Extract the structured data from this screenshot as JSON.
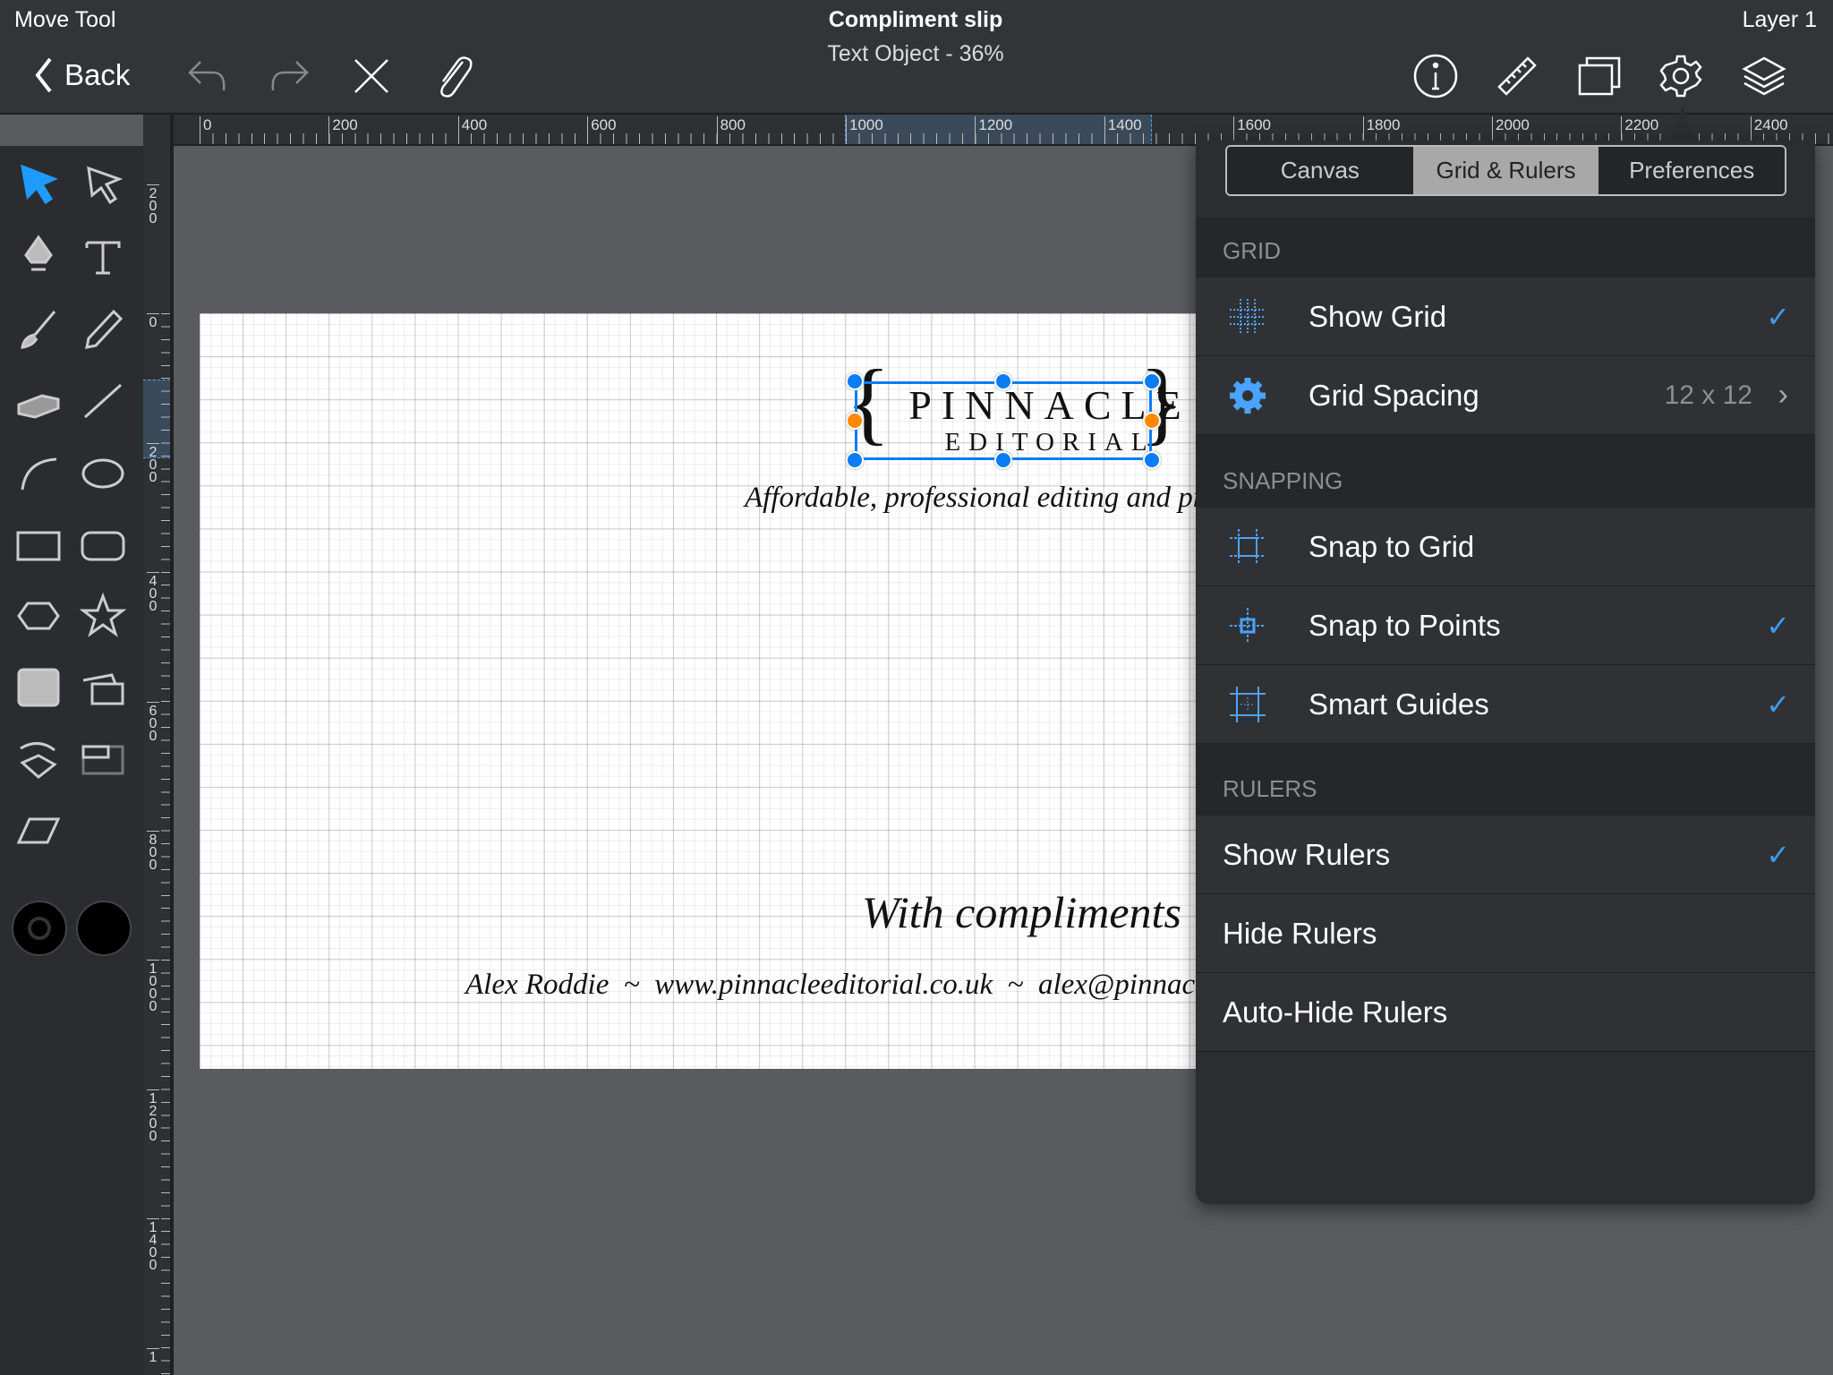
{
  "topbar": {
    "tool_name": "Move Tool",
    "doc_title": "Compliment slip",
    "subtitle": "Text Object - 36%",
    "layer": "Layer 1",
    "back_label": "Back"
  },
  "rulers": {
    "horizontal": [
      "0",
      "200",
      "400",
      "600",
      "800",
      "1000",
      "1200",
      "1400",
      "1600",
      "1800",
      "2000",
      "2200",
      "2400"
    ],
    "vertical": [
      "200",
      "0",
      "200",
      "400",
      "600",
      "800",
      "1000",
      "1200",
      "1400",
      "1"
    ]
  },
  "document": {
    "logo_line1": "PINNACLE",
    "logo_line2": "EDITORIAL",
    "tagline": "Affordable, professional editing and proofreading",
    "compliments": "With compliments",
    "footer": "Alex Roddie  ~  www.pinnacleeditorial.co.uk  ~  alex@pinnacleeditorial.co.uk"
  },
  "panel": {
    "tabs": [
      "Canvas",
      "Grid & Rulers",
      "Preferences"
    ],
    "active_tab": 1,
    "sections": {
      "grid": "GRID",
      "snapping": "SNAPPING",
      "rulers": "RULERS"
    },
    "rows": {
      "show_grid": "Show Grid",
      "grid_spacing": "Grid Spacing",
      "grid_spacing_value": "12 x 12",
      "snap_grid": "Snap to Grid",
      "snap_points": "Snap to Points",
      "smart_guides": "Smart Guides",
      "show_rulers": "Show Rulers",
      "hide_rulers": "Hide Rulers",
      "auto_hide": "Auto-Hide Rulers"
    },
    "checks": {
      "show_grid": true,
      "snap_grid": false,
      "snap_points": true,
      "smart_guides": true,
      "show_rulers": true
    },
    "check_glyph": "✓",
    "chevron": "›"
  },
  "colors": {
    "accent": "#0a7cf5",
    "check": "#3b9cf2",
    "handle_mid": "#ff8a00"
  }
}
